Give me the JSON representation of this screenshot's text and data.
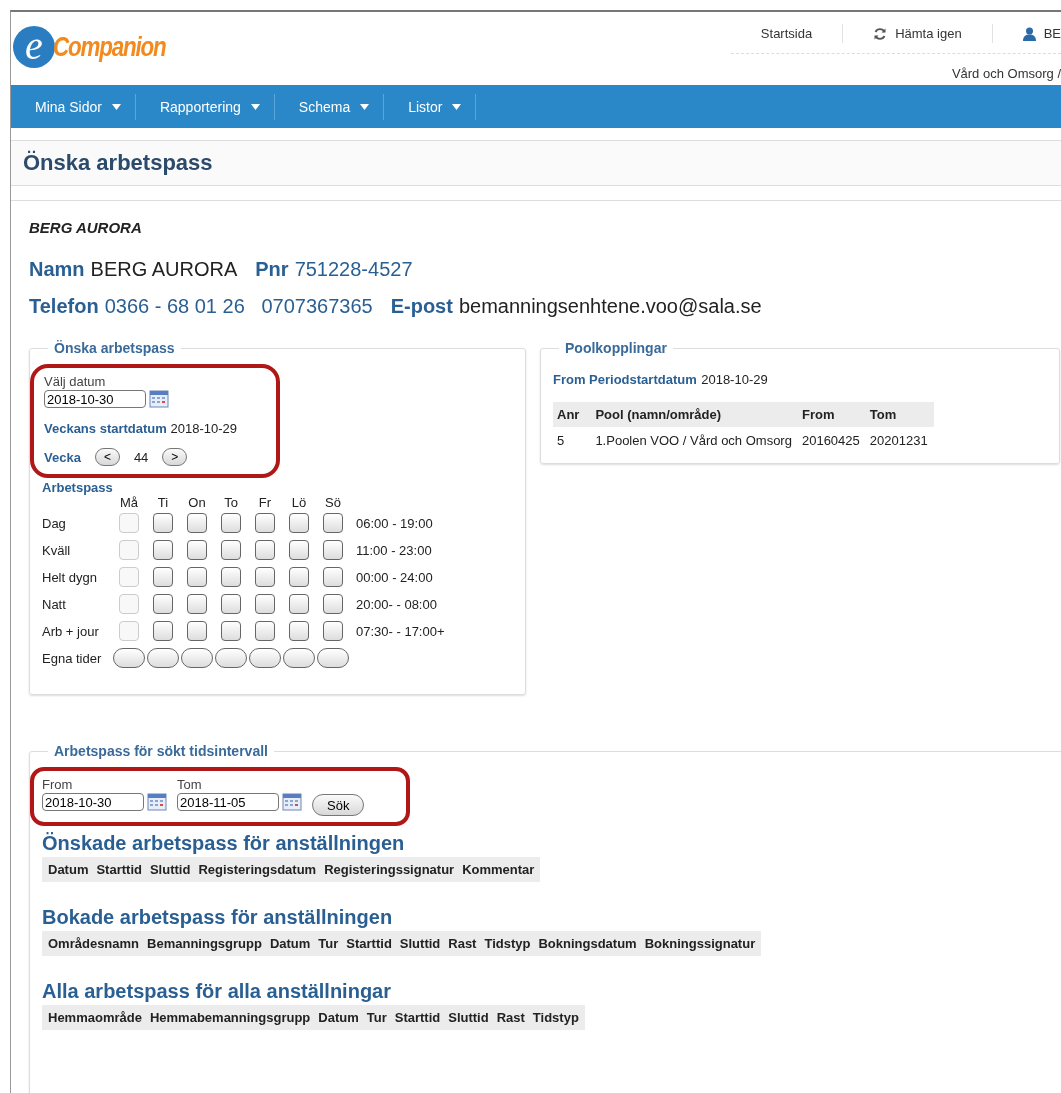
{
  "logo": {
    "mark": "e",
    "name": "Companion"
  },
  "top_links": [
    {
      "label": "Startsida",
      "kind": "plain"
    },
    {
      "label": "Hämta igen",
      "kind": "reload"
    },
    {
      "label": "BE",
      "kind": "account"
    }
  ],
  "org_path": "Vård och Omsorg /",
  "nav": [
    {
      "label": "Mina Sidor"
    },
    {
      "label": "Rapportering"
    },
    {
      "label": "Schema"
    },
    {
      "label": "Listor"
    }
  ],
  "page_title": "Önska arbetspass",
  "person_heading": "BERG AURORA",
  "info_lines": [
    [
      {
        "label": "Namn",
        "value": "BERG AURORA"
      },
      {
        "label": "Pnr",
        "value": "751228-4527"
      }
    ],
    [
      {
        "label": "Telefon",
        "value": "0366 - 68 01 26   0707367365"
      },
      {
        "label": "E-post",
        "value": "bemanningsenhtene.voo@sala.se"
      }
    ]
  ],
  "wish": {
    "legend": "Önska arbetspass",
    "highlighted": true,
    "date_label": "Välj datum",
    "date_value": "2018-10-30",
    "week_start_label": "Veckans startdatum",
    "week_start": "2018-10-29",
    "week_label": "Vecka",
    "prev": "<",
    "week": "44",
    "next": ">",
    "shifts_label": "Arbetspass",
    "days": [
      "Må",
      "Ti",
      "On",
      "To",
      "Fr",
      "Lö",
      "Sö"
    ],
    "shifts": [
      {
        "name": "Dag",
        "time": "06:00 - 19:00",
        "kind": "checkbox",
        "boxes": [
          {
            "checked": false,
            "disabled": true
          },
          {
            "checked": false,
            "disabled": false
          },
          {
            "checked": false,
            "disabled": false
          },
          {
            "checked": false,
            "disabled": false
          },
          {
            "checked": false,
            "disabled": false
          },
          {
            "checked": false,
            "disabled": false
          },
          {
            "checked": false,
            "disabled": false
          }
        ]
      },
      {
        "name": "Kväll",
        "time": "11:00 - 23:00",
        "kind": "checkbox",
        "boxes": [
          {
            "checked": false,
            "disabled": true
          },
          {
            "checked": false,
            "disabled": false
          },
          {
            "checked": false,
            "disabled": false
          },
          {
            "checked": false,
            "disabled": false
          },
          {
            "checked": false,
            "disabled": false
          },
          {
            "checked": false,
            "disabled": false
          },
          {
            "checked": false,
            "disabled": false
          }
        ]
      },
      {
        "name": "Helt dygn",
        "time": "00:00 - 24:00",
        "kind": "checkbox",
        "boxes": [
          {
            "checked": false,
            "disabled": true
          },
          {
            "checked": false,
            "disabled": false
          },
          {
            "checked": false,
            "disabled": false
          },
          {
            "checked": false,
            "disabled": false
          },
          {
            "checked": false,
            "disabled": false
          },
          {
            "checked": false,
            "disabled": false
          },
          {
            "checked": false,
            "disabled": false
          }
        ]
      },
      {
        "name": "Natt",
        "time": "20:00- - 08:00",
        "kind": "checkbox",
        "boxes": [
          {
            "checked": false,
            "disabled": true
          },
          {
            "checked": false,
            "disabled": false
          },
          {
            "checked": false,
            "disabled": false
          },
          {
            "checked": false,
            "disabled": false
          },
          {
            "checked": false,
            "disabled": false
          },
          {
            "checked": false,
            "disabled": false
          },
          {
            "checked": false,
            "disabled": false
          }
        ]
      },
      {
        "name": "Arb + jour",
        "time": "07:30- - 17:00+",
        "kind": "checkbox",
        "boxes": [
          {
            "checked": false,
            "disabled": true
          },
          {
            "checked": false,
            "disabled": false
          },
          {
            "checked": false,
            "disabled": false
          },
          {
            "checked": false,
            "disabled": false
          },
          {
            "checked": false,
            "disabled": false
          },
          {
            "checked": false,
            "disabled": false
          },
          {
            "checked": false,
            "disabled": false
          }
        ]
      },
      {
        "name": "Egna tider",
        "kind": "button",
        "boxes": [
          {
            "disabled": false
          },
          {
            "disabled": false
          },
          {
            "disabled": false
          },
          {
            "disabled": false
          },
          {
            "disabled": false
          },
          {
            "disabled": false
          },
          {
            "disabled": false
          }
        ]
      }
    ]
  },
  "pool": {
    "legend": "Poolkopplingar",
    "period_label": "From Periodstartdatum",
    "period": "2018-10-29",
    "columns": [
      "Anr",
      "Pool (namn/område)",
      "From",
      "Tom"
    ],
    "rows": [
      [
        "5",
        "1.Poolen VOO / Vård och Omsorg",
        "20160425",
        "20201231"
      ]
    ]
  },
  "range": {
    "legend": "Arbetspass för sökt tidsintervall",
    "highlighted": true,
    "from_label": "From",
    "from": "2018-10-30",
    "to_label": "Tom",
    "to": "2018-11-05",
    "search": "Sök"
  },
  "tables": [
    {
      "title": "Önskade arbetspass för anställningen",
      "columns": [
        "Datum",
        "Starttid",
        "Sluttid",
        "Registeringsdatum",
        "Registeringssignatur",
        "Kommentar"
      ]
    },
    {
      "title": "Bokade arbetspass för anställningen",
      "columns": [
        "Områdesnamn",
        "Bemanningsgrupp",
        "Datum",
        "Tur",
        "Starttid",
        "Sluttid",
        "Rast",
        "Tidstyp",
        "Bokningsdatum",
        "Bokningssignatur"
      ]
    },
    {
      "title": "Alla arbetspass för alla anställningar",
      "columns": [
        "Hemmaområde",
        "Hemmabemanningsgrupp",
        "Datum",
        "Tur",
        "Starttid",
        "Sluttid",
        "Rast",
        "Tidstyp"
      ]
    }
  ]
}
